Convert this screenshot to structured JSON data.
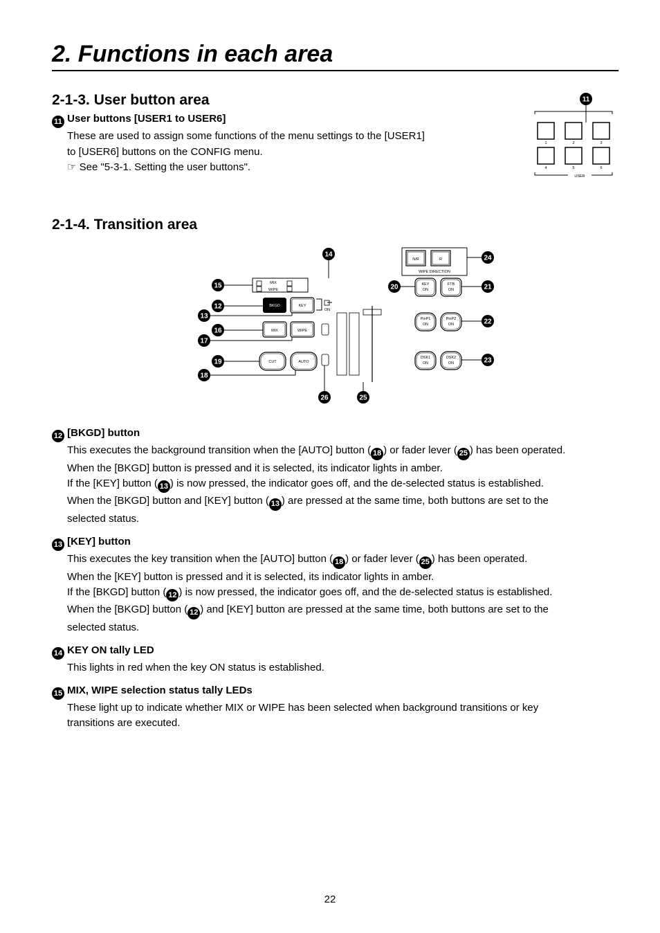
{
  "chapter_title": "2. Functions in each area",
  "section_213": {
    "title": "2-1-3. User button area",
    "callout": "11",
    "item11_title": "User buttons [USER1 to USER6]",
    "line1": "These are used to assign some functions of the menu settings to the [USER1]",
    "line2": "to [USER6] buttons on the CONFIG menu.",
    "line3": "See \"5-3-1. Setting the user buttons\".",
    "pad_labels": {
      "k1": "1",
      "k2": "2",
      "k3": "3",
      "k4": "4",
      "k5": "5",
      "k6": "6",
      "group": "USER"
    }
  },
  "section_214": {
    "title": "2-1-4. Transition area",
    "callouts": {
      "c12": "12",
      "c13": "13",
      "c14": "14",
      "c15": "15",
      "c16": "16",
      "c17": "17",
      "c18": "18",
      "c19": "19",
      "c20": "20",
      "c21": "21",
      "c22": "22",
      "c23": "23",
      "c24": "24",
      "c25": "25",
      "c26": "26"
    },
    "labels": {
      "nr": "N/R",
      "r": "R",
      "wipe_dir": "WIPE DIRECTION",
      "mix": "MIX",
      "wipe": "WIPE",
      "bkgd": "BKGD",
      "key": "KEY",
      "on": "ON",
      "keyon": "KEY",
      "ftb": "FTB",
      "pinp1": "PinP1",
      "pinp2": "PinP2",
      "dsk1": "DSK1",
      "dsk2": "DSK2",
      "mixbtn": "MIX",
      "wipebtn": "WIPE",
      "cut": "CUT",
      "auto": "AUTO"
    }
  },
  "item12": {
    "title": "[BKGD] button",
    "l1a": "This executes the background transition when the [AUTO] button (",
    "l1b": ") or fader lever (",
    "l1c": ") has been operated.",
    "l2": "When the [BKGD] button is pressed and it is selected, its indicator lights in amber.",
    "l3a": "If the [KEY] button (",
    "l3b": ") is now pressed, the indicator goes off, and the de-selected status is established.",
    "l4a": "When the [BKGD] button and [KEY] button (",
    "l4b": ") are pressed at the same time, both buttons are set to the",
    "l5": "selected status."
  },
  "item13": {
    "title": "[KEY] button",
    "l1a": "This executes the key transition when the [AUTO] button (",
    "l1b": ") or fader lever (",
    "l1c": ") has been operated.",
    "l2": "When the [KEY] button is pressed and it is selected, its indicator lights in amber.",
    "l3a": "If the [BKGD] button (",
    "l3b": ") is now pressed, the indicator goes off, and the de-selected status is established.",
    "l4a": "When the [BKGD] button (",
    "l4b": ") and [KEY] button are pressed at the same time, both buttons are set to the",
    "l5": "selected status."
  },
  "item14": {
    "title": "KEY ON tally LED",
    "l1": "This lights in red when the key ON status is established."
  },
  "item15": {
    "title": "MIX, WIPE selection status tally LEDs",
    "l1": "These light up to indicate whether MIX or WIPE has been selected when background transitions or key",
    "l2": "transitions are executed."
  },
  "refs": {
    "r18": "18",
    "r25": "25",
    "r13": "13",
    "r12": "12"
  },
  "page_number": "22"
}
